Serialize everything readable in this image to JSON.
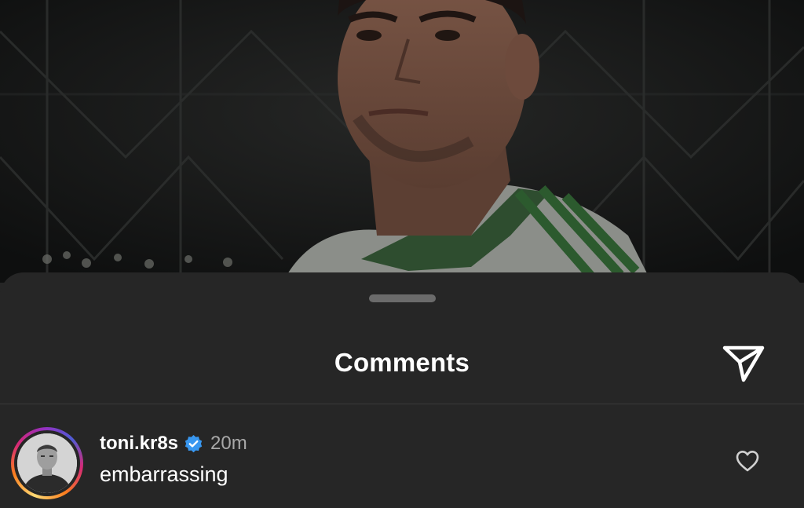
{
  "post": {
    "image_icon": "player-portrait-photo"
  },
  "sheet": {
    "title": "Comments",
    "share_icon": "paper-plane-icon"
  },
  "comments": [
    {
      "username": "toni.kr8s",
      "verified": true,
      "time": "20m",
      "text": "embarrassing",
      "like_icon": "heart-outline-icon"
    }
  ],
  "colors": {
    "sheet_bg": "#262626",
    "text_primary": "#ffffff",
    "text_secondary": "#a8a8a8",
    "verified_blue": "#3897f0"
  }
}
